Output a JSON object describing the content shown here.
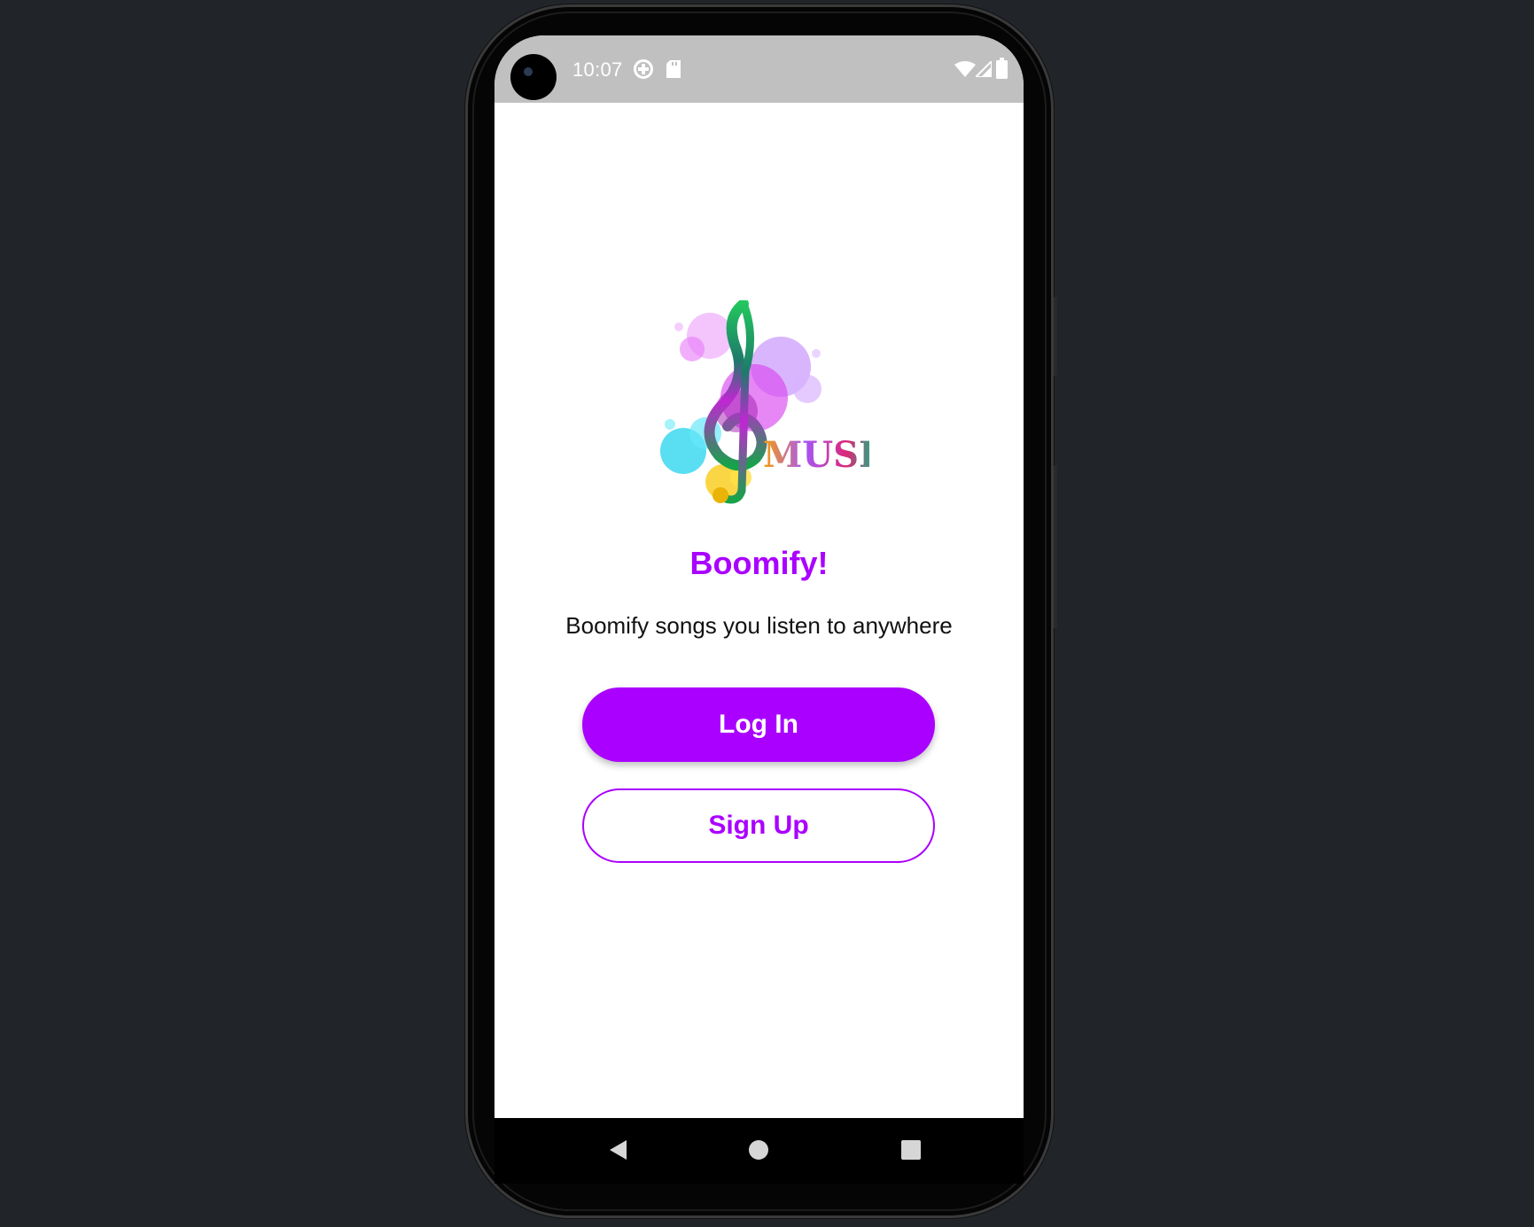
{
  "status_bar": {
    "time": "10:07",
    "left_icons": [
      "data-saver-icon",
      "sd-card-icon"
    ],
    "right_icons": [
      "wifi-icon",
      "signal-icon",
      "battery-icon"
    ],
    "background": "#c0c0c0"
  },
  "app": {
    "logo_text": "MUSIC",
    "title": "Boomify!",
    "tagline": "Boomify songs you listen to anywhere",
    "accent_color": "#aa00ff"
  },
  "buttons": {
    "login_label": "Log In",
    "signup_label": "Sign Up"
  },
  "nav_bar": {
    "icons": [
      "back-icon",
      "home-icon",
      "recents-icon"
    ]
  }
}
